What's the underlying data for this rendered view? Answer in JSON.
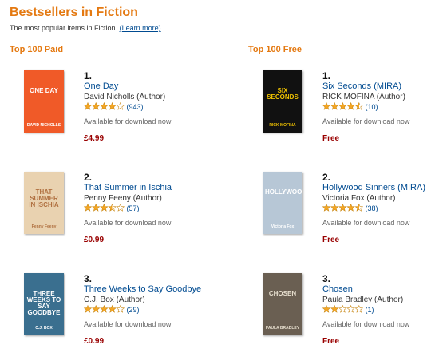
{
  "page": {
    "title": "Bestsellers in Fiction",
    "subtitle": "The most popular items in Fiction.",
    "learn_more": "(Learn more)"
  },
  "paid": {
    "heading": "Top 100 Paid",
    "items": [
      {
        "rank": "1.",
        "title": "One Day",
        "author": "David Nicholls (Author)",
        "rating": 4.0,
        "reviews": "(943)",
        "availability": "Available for download now",
        "price": "£4.99",
        "cover": {
          "bg": "#f05a28",
          "text": "ONE DAY",
          "text2": "DAVID NICHOLLS",
          "fg": "#ffffff"
        }
      },
      {
        "rank": "2.",
        "title": "That Summer in Ischia",
        "author": "Penny Feeny (Author)",
        "rating": 3.5,
        "reviews": "(57)",
        "availability": "Available for download now",
        "price": "£0.99",
        "cover": {
          "bg": "#e9d2b0",
          "text": "THAT SUMMER IN ISCHIA",
          "text2": "Penny Feeny",
          "fg": "#b07040"
        }
      },
      {
        "rank": "3.",
        "title": "Three Weeks to Say Goodbye",
        "author": "C.J. Box (Author)",
        "rating": 4.0,
        "reviews": "(29)",
        "availability": "Available for download now",
        "price": "£0.99",
        "cover": {
          "bg": "#3a6f8f",
          "text": "THREE WEEKS TO SAY GOODBYE",
          "text2": "C.J. BOX",
          "fg": "#ffffff"
        }
      }
    ]
  },
  "free": {
    "heading": "Top 100 Free",
    "items": [
      {
        "rank": "1.",
        "title": "Six Seconds (MIRA)",
        "author": "RICK MOFINA (Author)",
        "rating": 4.5,
        "reviews": "(10)",
        "availability": "Available for download now",
        "price": "Free",
        "cover": {
          "bg": "#111111",
          "text": "SIX SECONDS",
          "text2": "RICK MOFINA",
          "fg": "#f2c400"
        }
      },
      {
        "rank": "2.",
        "title": "Hollywood Sinners (MIRA)",
        "author": "Victoria Fox (Author)",
        "rating": 4.5,
        "reviews": "(38)",
        "availability": "Available for download now",
        "price": "Free",
        "cover": {
          "bg": "#b7c7d6",
          "text": "HOLLYWOOD",
          "text2": "Victoria Fox",
          "fg": "#ffffff"
        }
      },
      {
        "rank": "3.",
        "title": "Chosen",
        "author": "Paula Bradley (Author)",
        "rating": 2.0,
        "reviews": "(1)",
        "availability": "Available for download now",
        "price": "Free",
        "cover": {
          "bg": "#6a5f52",
          "text": "CHOSEN",
          "text2": "PAULA BRADLEY",
          "fg": "#e8e0d0"
        }
      }
    ]
  },
  "colors": {
    "accent": "#e47911",
    "link": "#004b91",
    "price": "#990000",
    "star": "#f5a623"
  }
}
